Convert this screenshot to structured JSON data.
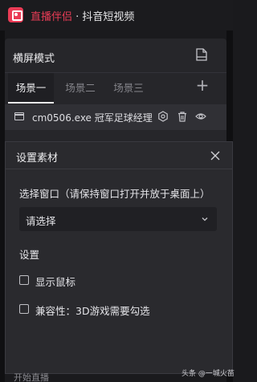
{
  "app": {
    "name": "直播伴侣",
    "separator": " · ",
    "platform": "抖音短视频"
  },
  "scene_panel": {
    "title": "横屏模式",
    "tabs": [
      {
        "label": "场景一",
        "active": true
      },
      {
        "label": "场景二",
        "active": false
      },
      {
        "label": "场景三",
        "active": false
      }
    ],
    "source": {
      "name": "cm0506.exe 冠军足球经理"
    }
  },
  "dialog": {
    "title": "设置素材",
    "window_label": "选择窗口（请保持窗口打开并放于桌面上）",
    "select_value": "请选择",
    "settings_title": "设置",
    "show_cursor_label": "显示鼠标",
    "show_cursor_checked": false,
    "compat_label": "兼容性：3D游戏需要勾选",
    "compat_checked": false
  },
  "bottom_bar": {
    "partial_text": "开始直播"
  },
  "watermark": "头条 @一城火苗",
  "colors": {
    "accent": "#ea3c56",
    "panel": "#26262a",
    "dialog": "#2a2a2e"
  }
}
